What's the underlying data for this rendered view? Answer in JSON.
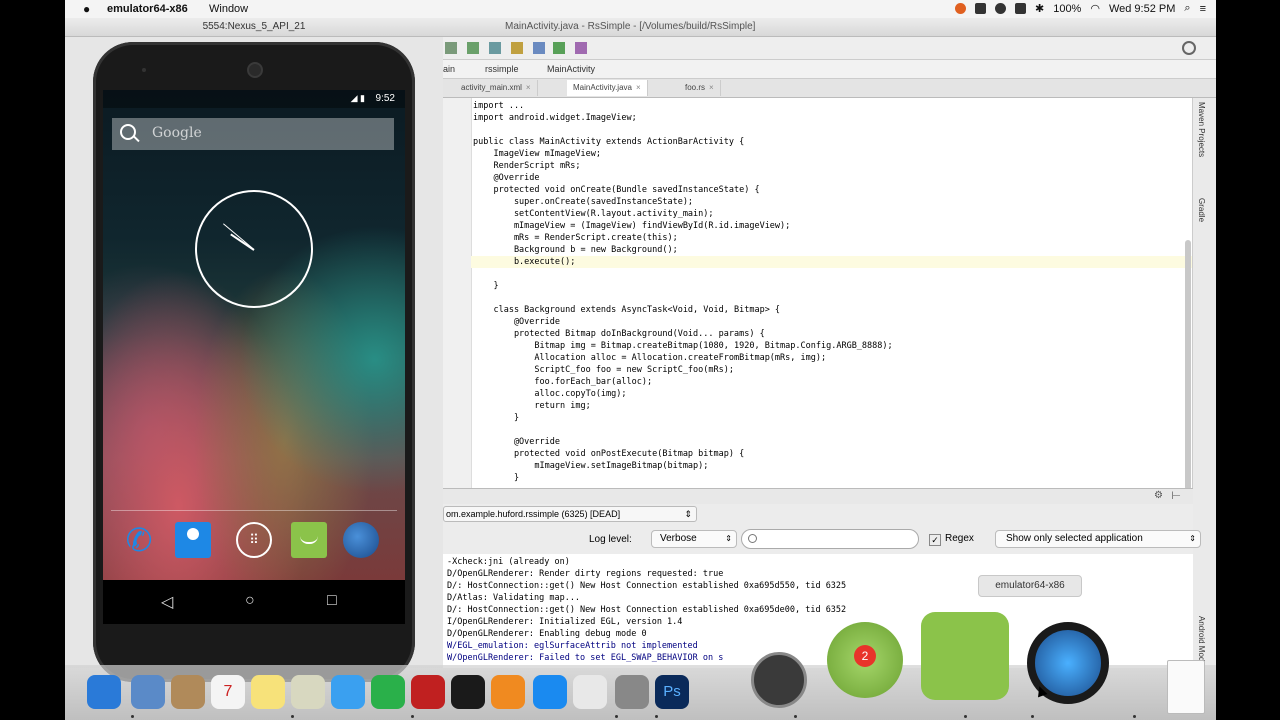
{
  "menubar": {
    "app_name": "emulator64-x86",
    "window_menu": "Window",
    "battery": "100%",
    "clock": "Wed 9:52 PM"
  },
  "emulator": {
    "title": "5554:Nexus_5_API_21",
    "status_time": "9:52",
    "search_hint": "Google"
  },
  "ide": {
    "title": "MainActivity.java - RsSimple - [/Volumes/build/RsSimple]",
    "breadcrumb": [
      "ain",
      "rssimple",
      "MainActivity"
    ],
    "tabs": [
      {
        "label": "activity_main.xml",
        "active": false
      },
      {
        "label": "MainActivity.java",
        "active": true
      },
      {
        "label": "foo.rs",
        "active": false
      }
    ],
    "code": [
      "import ...",
      "import android.widget.ImageView;",
      "",
      "public class MainActivity extends ActionBarActivity {",
      "    ImageView mImageView;",
      "    RenderScript mRs;",
      "    @Override",
      "    protected void onCreate(Bundle savedInstanceState) {",
      "        super.onCreate(savedInstanceState);",
      "        setContentView(R.layout.activity_main);",
      "        mImageView = (ImageView) findViewById(R.id.imageView);",
      "        mRs = RenderScript.create(this);",
      "        Background b = new Background();",
      "        b.execute();",
      "",
      "    }",
      "",
      "    class Background extends AsyncTask<Void, Void, Bitmap> {",
      "        @Override",
      "        protected Bitmap doInBackground(Void... params) {",
      "            Bitmap img = Bitmap.createBitmap(1080, 1920, Bitmap.Config.ARGB_8888);",
      "            Allocation alloc = Allocation.createFromBitmap(mRs, img);",
      "            ScriptC_foo foo = new ScriptC_foo(mRs);",
      "            foo.forEach_bar(alloc);",
      "            alloc.copyTo(img);",
      "            return img;",
      "        }",
      "",
      "        @Override",
      "        protected void onPostExecute(Bitmap bitmap) {",
      "            mImageView.setImageBitmap(bitmap);",
      "        }"
    ],
    "sidebar_tabs": [
      "Maven Projects",
      "Gradle",
      "Android Mode"
    ]
  },
  "logcat": {
    "process": "om.example.huford.rssimple (6325) [DEAD]",
    "log_level_label": "Log level:",
    "log_level": "Verbose",
    "regex_label": "Regex",
    "regex_checked": true,
    "filter": "Show only selected application",
    "lines": [
      "-Xcheck:jni (already on)",
      "D/OpenGLRenderer: Render dirty regions requested: true",
      "D/: HostConnection::get() New Host Connection established 0xa695d550, tid 6325",
      "D/Atlas: Validating map...",
      "D/: HostConnection::get() New Host Connection established 0xa695de00, tid 6352",
      "I/OpenGLRenderer: Initialized EGL, version 1.4",
      "D/OpenGLRenderer: Enabling debug mode 0",
      "W/EGL_emulation: eglSurfaceAttrib not implemented",
      "W/OpenGLRenderer: Failed to set EGL_SWAP_BEHAVIOR on s"
    ]
  },
  "dock": {
    "tooltip": "emulator64-x86",
    "badge": "2",
    "icons": [
      "safari-icon",
      "preview-icon",
      "contacts-icon",
      "calendar-icon",
      "notes-icon",
      "photos-icon",
      "messages-icon",
      "facetime-icon",
      "photo-booth-icon",
      "itunes-icon",
      "ibooks-icon",
      "app-store-icon",
      "chrome-icon",
      "system-preferences-icon",
      "photoshop-icon",
      "xcode-icon",
      "android-studio-icon",
      "android-emulator-icon",
      "quicktime-icon",
      "document-icon"
    ],
    "calendar_day": "7",
    "photoshop_label": "Ps"
  }
}
